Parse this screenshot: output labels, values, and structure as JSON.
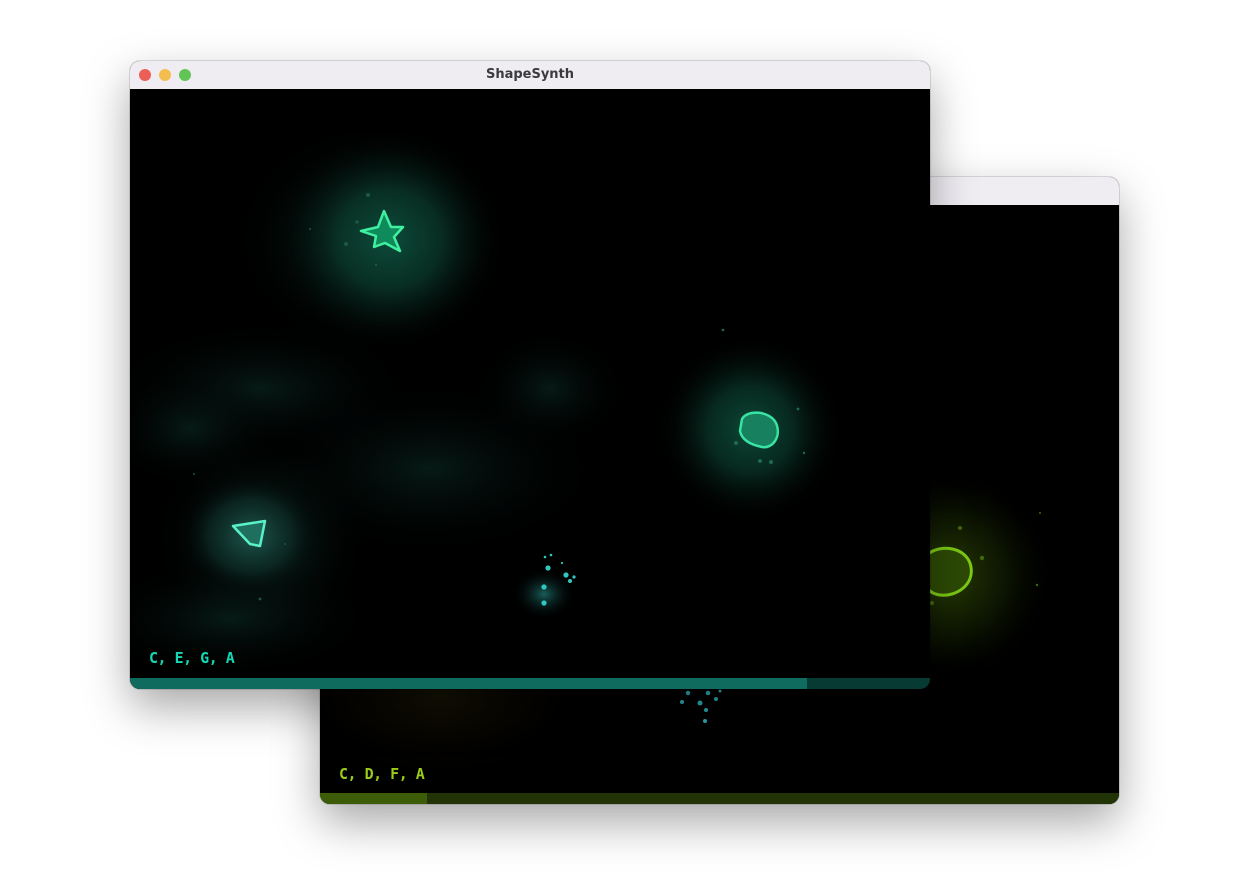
{
  "front_window": {
    "title": "ShapeSynth",
    "chords": "C, E, G, A",
    "progress": 0.846,
    "accent": "#14d8b4",
    "progress_color": "#0e6b5d",
    "progress_track_color": "#073a33",
    "shapes": [
      "star-shape",
      "blob-shape",
      "pentagon-shape",
      "particle-cluster"
    ]
  },
  "back_window": {
    "title": "",
    "chords": "C, D, F, A",
    "progress": 0.134,
    "accent": "#9ccc1a",
    "progress_color": "#3d5c08",
    "progress_track_color": "#223305",
    "shapes": [
      "blob-shape",
      "particle-cluster"
    ]
  },
  "traffic_lights": {
    "close_color": "#ec5f57",
    "minimize_color": "#f4bd4f",
    "zoom_color": "#61c454"
  }
}
